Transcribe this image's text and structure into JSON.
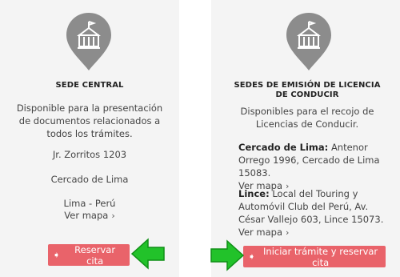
{
  "left": {
    "title": "SEDE CENTRAL",
    "description": "Disponible para la presentación de documentos relacionados a todos los trámites.",
    "address": "Jr. Zorritos 1203",
    "district": "Cercado de Lima",
    "city": "Lima - Perú",
    "map_link": "Ver mapa",
    "button_label": "Reservar cita"
  },
  "right": {
    "title": "SEDES DE EMISIÓN DE LICENCIA DE CONDUCIR",
    "description": "Disponibles para el recojo de Licencias de Conducir.",
    "locations": [
      {
        "name": "Cercado de Lima:",
        "address": "Antenor Orrego 1996, Cercado de Lima 15083.",
        "map_link": "Ver mapa"
      },
      {
        "name": "Lince:",
        "address": "Local del Touring y Automóvil Club del Perú, Av. César Vallejo 603, Lince 15073.",
        "map_link": "Ver mapa"
      }
    ],
    "button_label": "Iniciar trámite y reservar cita"
  },
  "colors": {
    "button": "#e9636a",
    "pin": "#8c8c8c",
    "arrow": "#22c22a",
    "card": "#f4f4f4"
  },
  "icons": {
    "pin": "building-pin-icon",
    "button": "sign-in-icon",
    "arrow": "arrow-right-icon"
  }
}
